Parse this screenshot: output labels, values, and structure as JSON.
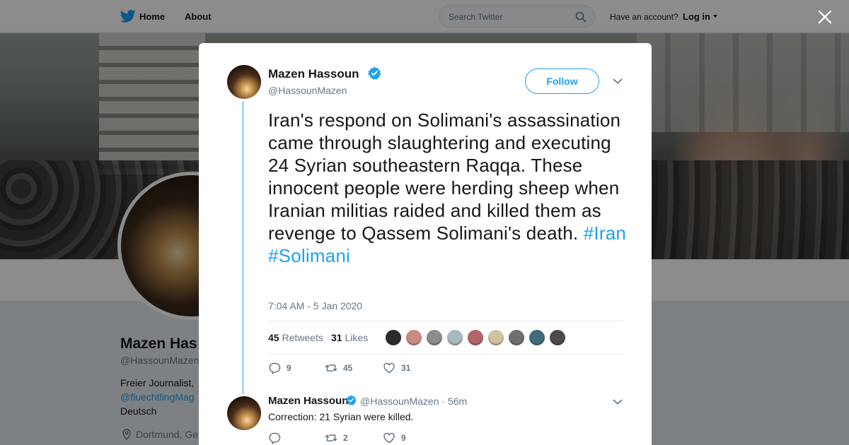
{
  "nav": {
    "home_label": "Home",
    "about_label": "About",
    "search_placeholder": "Search Twitter",
    "have_account": "Have an account?",
    "login_label": "Log in",
    "brand_color": "#1da1f2"
  },
  "profile": {
    "name": "Mazen Has",
    "handle": "@HassounMazen",
    "bio": "Freier Journalist,",
    "mention": "@fluechtlingMag",
    "language": "Deutsch",
    "location": "Dortmund, Ge"
  },
  "tweet": {
    "author_name": "Mazen Hassoun",
    "author_handle": "@HassounMazen",
    "follow_label": "Follow",
    "text": "Iran's respond on Solimani's assassination came through slaughtering and executing 24 Syrian southeastern Raqqa. These innocent people were herding sheep when Iranian militias raided and killed them as revenge to Qassem Solimani's death.",
    "hashtags": [
      "#Iran",
      "#Solimani"
    ],
    "timestamp": "7:04 AM - 5 Jan 2020",
    "retweets_count": "45",
    "retweets_label": "Retweets",
    "likes_count": "31",
    "likes_label": "Likes",
    "liker_faces": [
      "#2b2b2b",
      "#c98a86",
      "#8c8c8c",
      "#aab8c2",
      "#b5646a",
      "#cfc2a2",
      "#6f6f6f",
      "#3f6b7a",
      "#4a4a4a"
    ],
    "actions": {
      "replies": "9",
      "retweets": "45",
      "likes": "31"
    }
  },
  "reply": {
    "author_name": "Mazen Hassoun",
    "author_handle": "@HassounMazen",
    "age": "· 56m",
    "text": "Correction: 21 Syrian were killed.",
    "actions": {
      "replies": "",
      "retweets": "2",
      "likes": "9"
    }
  }
}
